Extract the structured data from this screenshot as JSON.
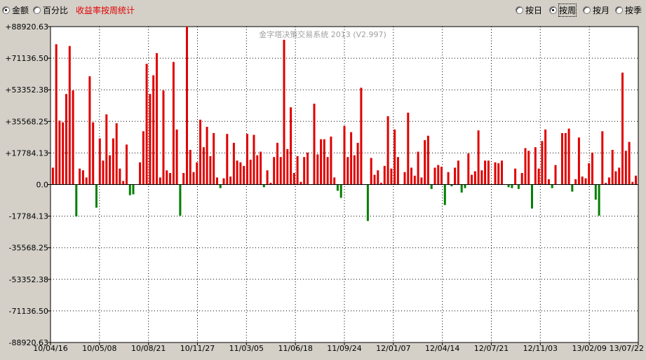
{
  "toolbar": {
    "mode_options": [
      {
        "label": "金额",
        "selected": true
      },
      {
        "label": "百分比",
        "selected": false
      }
    ],
    "caption": "收益率按周统计",
    "period_options": [
      {
        "label": "按日",
        "selected": false
      },
      {
        "label": "按周",
        "selected": true
      },
      {
        "label": "按月",
        "selected": false
      },
      {
        "label": "按季",
        "selected": false
      }
    ]
  },
  "colors": {
    "positive": "#e00000",
    "negative": "#008000",
    "background": "#ffffff",
    "grid": "#000000"
  },
  "chart_data": {
    "type": "bar",
    "watermark": "金字塔决策交易系统 2013 (V2.997)",
    "ylim": [
      -88920.63,
      88920.63
    ],
    "y_ticks": [
      "+88920.63",
      "+71136.50",
      "+53352.38",
      "+35568.25",
      "+17784.13",
      "0.0",
      "-17784.13",
      "-35568.25",
      "-53352.38",
      "-71136.50",
      "-88920.63"
    ],
    "x_ticks": [
      "10/04/16",
      "10/05/08",
      "10/08/21",
      "10/11/27",
      "11/03/05",
      "11/06/18",
      "11/09/24",
      "12/01/07",
      "12/04/14",
      "12/07/21",
      "12/11/03",
      "13/02/09",
      "13/07/22"
    ],
    "grid": true,
    "values": [
      9500,
      79000,
      36000,
      35000,
      51000,
      78000,
      53000,
      -18000,
      9000,
      8000,
      4000,
      61000,
      35000,
      -13000,
      26000,
      13500,
      39500,
      16500,
      26000,
      34500,
      9000,
      2000,
      22500,
      -6000,
      -5500,
      0,
      12500,
      30000,
      68000,
      51000,
      61500,
      74000,
      4000,
      53000,
      8000,
      6500,
      69000,
      31000,
      -17500,
      6500,
      89000,
      19500,
      7000,
      12500,
      36500,
      21000,
      32500,
      16000,
      29000,
      4000,
      -2000,
      3500,
      28500,
      4500,
      23500,
      13500,
      12500,
      10500,
      28500,
      14000,
      28000,
      16500,
      18500,
      -1500,
      8000,
      1000,
      15500,
      23500,
      15500,
      81500,
      20000,
      43500,
      6500,
      16000,
      1500,
      15500,
      18000,
      0,
      45500,
      17000,
      25500,
      25500,
      15500,
      27000,
      4000,
      -3500,
      -7500,
      33000,
      15500,
      29500,
      16500,
      23500,
      54500,
      0,
      -20500,
      15000,
      5500,
      8000,
      1000,
      10500,
      38500,
      9000,
      31000,
      15500,
      0,
      7000,
      40500,
      9500,
      5000,
      18500,
      4000,
      25000,
      27500,
      -2500,
      9500,
      11000,
      10000,
      -11500,
      7000,
      -1000,
      9500,
      13500,
      -4500,
      -2000,
      17500,
      5500,
      7500,
      30500,
      8000,
      13500,
      13500,
      0,
      12500,
      12000,
      13500,
      0,
      -1500,
      -2000,
      9000,
      -2500,
      6500,
      20500,
      19000,
      -13500,
      21000,
      9000,
      24500,
      31000,
      3000,
      -2000,
      11000,
      0,
      29000,
      29000,
      31500,
      -4000,
      3000,
      26500,
      4500,
      3500,
      12000,
      18000,
      -8500,
      -17500,
      30000,
      1000,
      4000,
      19500,
      7500,
      9500,
      63000,
      19000,
      24000,
      1500,
      5000
    ]
  }
}
